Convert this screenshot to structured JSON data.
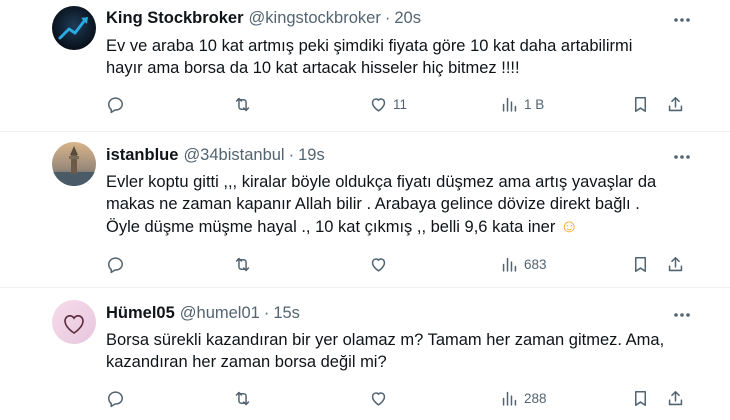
{
  "tweets": [
    {
      "name": "King Stockbroker",
      "handle": "@kingstockbroker",
      "separator": "·",
      "time": "20s",
      "text_lines": [
        "Ev ve araba 10 kat artmış peki şimdiki fiyata göre 10 kat daha artabilirmi",
        "hayır ama borsa da 10 kat artacak hisseler hiç bitmez !!!!"
      ],
      "likes": "11",
      "views": "1 B"
    },
    {
      "name": "istanblue",
      "handle": "@34bistanbul",
      "separator": "·",
      "time": "19s",
      "text_lines": [
        "Evler koptu gitti ,,, kiralar böyle oldukça fiyatı düşmez ama artış yavaşlar da",
        "makas ne zaman kapanır Allah bilir . Arabaya gelince dövize direkt bağlı .",
        "Öyle düşme müşme hayal ., 10 kat çıkmış ,, belli 9,6 kata iner"
      ],
      "emoji": "☺",
      "likes": "",
      "views": "683"
    },
    {
      "name": "Hümel05",
      "handle": "@humel01",
      "separator": "·",
      "time": "15s",
      "text_lines": [
        "Borsa sürekli kazandıran bir yer olamaz m? Tamam her zaman gitmez. Ama,",
        "kazandıran her zaman borsa değil mi?"
      ],
      "likes": "",
      "views": "288"
    }
  ],
  "icons": {
    "reply": "reply-icon",
    "repost": "repost-icon",
    "like": "heart-icon",
    "views": "views-icon",
    "bookmark": "bookmark-icon",
    "share": "share-icon",
    "more": "more-icon"
  },
  "colors": {
    "text": "#0f1419",
    "secondary": "#536471",
    "divider": "#eff3f4",
    "emoji": "#f5a623"
  }
}
